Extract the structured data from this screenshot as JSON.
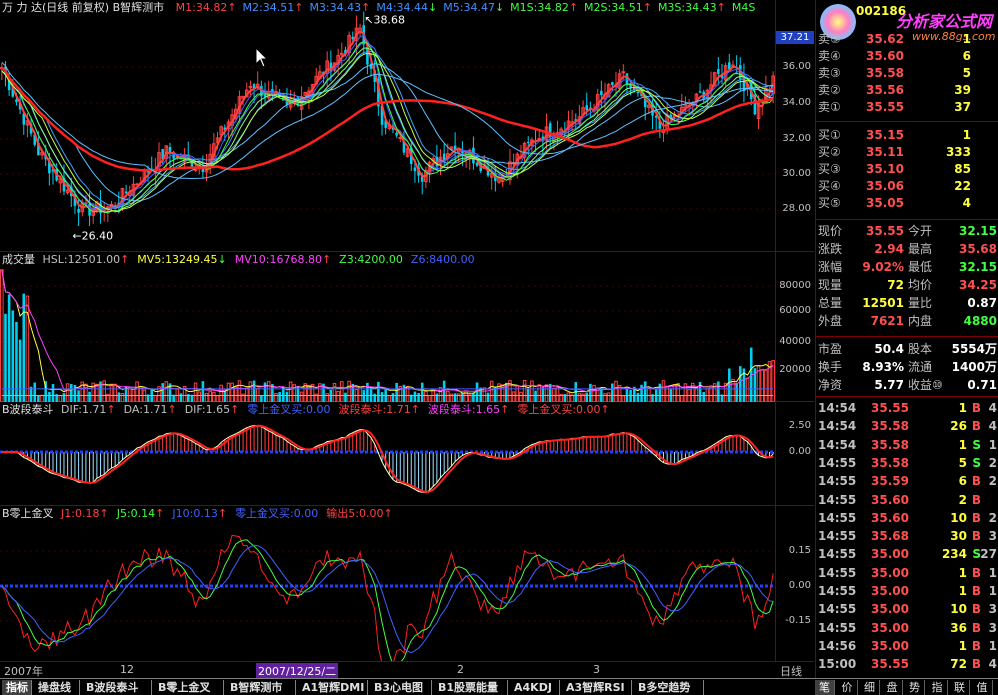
{
  "colors": {
    "up": "#ff4040",
    "down": "#00c0e0",
    "yellow": "#ffff40",
    "green": "#40ff40",
    "magenta": "#ff40ff",
    "white": "#ffffff",
    "blue": "#4060ff",
    "grid": "#800000"
  },
  "main": {
    "title": "万 力 达(日线 前复权) B智辉测市",
    "ma": [
      {
        "label": "M1:34.82",
        "color": "#ff4040",
        "arrow": "↑"
      },
      {
        "label": "M2:34.51",
        "color": "#4090ff",
        "arrow": "↑"
      },
      {
        "label": "M3:34.43",
        "color": "#4090ff",
        "arrow": "↑"
      },
      {
        "label": "M4:34.44",
        "color": "#4090ff",
        "arrow": "↓"
      },
      {
        "label": "M5:34.47",
        "color": "#4090ff",
        "arrow": "↓"
      },
      {
        "label": "M1S:34.82",
        "color": "#40ff40",
        "arrow": "↑"
      },
      {
        "label": "M2S:34.51",
        "color": "#40ff40",
        "arrow": "↑"
      },
      {
        "label": "M3S:34.43",
        "color": "#40ff40",
        "arrow": "↑"
      },
      {
        "label": "M4S",
        "color": "#40ff40",
        "arrow": ""
      }
    ],
    "high_label": "38.68",
    "low_label": "←26.40",
    "current_price_tag": "37.21",
    "axis": [
      "36.00",
      "34.00",
      "32.00",
      "30.00",
      "28.00"
    ]
  },
  "volume": {
    "title": "成交量",
    "items": [
      {
        "label": "HSL:12501.00",
        "color": "#c0c0c0",
        "arrow": "↑"
      },
      {
        "label": "MV5:13249.45",
        "color": "#ffff40",
        "arrow": "↓"
      },
      {
        "label": "MV10:16768.80",
        "color": "#ff40ff",
        "arrow": "↑"
      },
      {
        "label": "Z3:4200.00",
        "color": "#40ff40",
        "arrow": ""
      },
      {
        "label": "Z6:8400.00",
        "color": "#4060ff",
        "arrow": ""
      }
    ],
    "axis": [
      "80000",
      "60000",
      "40000",
      "20000"
    ]
  },
  "wave": {
    "title": "B波段泰斗",
    "items": [
      {
        "label": "DIF:1.71",
        "color": "#c0c0c0",
        "arrow": "↑"
      },
      {
        "label": "DA:1.71",
        "color": "#c0c0c0",
        "arrow": "↑"
      },
      {
        "label": "DIF:1.65",
        "color": "#c0c0c0",
        "arrow": "↑"
      },
      {
        "label": "零上金叉买:0.00",
        "color": "#4060ff",
        "arrow": ""
      },
      {
        "label": "波段泰斗:1.71",
        "color": "#ff4040",
        "arrow": "↑"
      },
      {
        "label": "波段泰斗:1.65",
        "color": "#ff40ff",
        "arrow": "↑"
      },
      {
        "label": "零上金叉买:0.00",
        "color": "#ff4040",
        "arrow": "↑"
      }
    ],
    "axis": [
      "2.50",
      "0.00"
    ]
  },
  "zero": {
    "title": "B零上金叉",
    "items": [
      {
        "label": "J1:0.18",
        "color": "#ff4040",
        "arrow": "↑"
      },
      {
        "label": "J5:0.14",
        "color": "#40ff40",
        "arrow": "↑"
      },
      {
        "label": "J10:0.13",
        "color": "#4060ff",
        "arrow": "↑"
      },
      {
        "label": "零上金叉买:0.00",
        "color": "#4060ff",
        "arrow": ""
      },
      {
        "label": "输出5:0.00",
        "color": "#ff4040",
        "arrow": "↑"
      }
    ],
    "axis": [
      "0.15",
      "0.00",
      "-0.15"
    ]
  },
  "date_axis": {
    "labels": [
      {
        "text": "2007年",
        "pos": 0.005
      },
      {
        "text": "12",
        "pos": 0.155
      },
      {
        "text": "2007/12/25/二",
        "pos": 0.33
      },
      {
        "text": "2",
        "pos": 0.59
      },
      {
        "text": "3",
        "pos": 0.765
      }
    ],
    "period": "日线"
  },
  "quote": {
    "code": "002186",
    "sell": [
      {
        "label": "卖⑤",
        "price": "35.62",
        "vol": "1"
      },
      {
        "label": "卖④",
        "price": "35.60",
        "vol": "6"
      },
      {
        "label": "卖③",
        "price": "35.58",
        "vol": "5"
      },
      {
        "label": "卖②",
        "price": "35.56",
        "vol": "39"
      },
      {
        "label": "卖①",
        "price": "35.55",
        "vol": "37"
      }
    ],
    "buy": [
      {
        "label": "买①",
        "price": "35.15",
        "vol": "1"
      },
      {
        "label": "买②",
        "price": "35.11",
        "vol": "333"
      },
      {
        "label": "买③",
        "price": "35.10",
        "vol": "85"
      },
      {
        "label": "买④",
        "price": "35.06",
        "vol": "22"
      },
      {
        "label": "买⑤",
        "price": "35.05",
        "vol": "4"
      }
    ],
    "stats": [
      {
        "l1": "现价",
        "v1": "35.55",
        "c1": "#ff5050",
        "l2": "今开",
        "v2": "32.15",
        "c2": "#40ff40"
      },
      {
        "l1": "涨跌",
        "v1": "2.94",
        "c1": "#ff5050",
        "l2": "最高",
        "v2": "35.68",
        "c2": "#ff5050"
      },
      {
        "l1": "涨幅",
        "v1": "9.02%",
        "c1": "#ff5050",
        "l2": "最低",
        "v2": "32.15",
        "c2": "#40ff40"
      },
      {
        "l1": "现量",
        "v1": "72",
        "c1": "#ffff40",
        "l2": "均价",
        "v2": "34.25",
        "c2": "#ff5050"
      },
      {
        "l1": "总量",
        "v1": "12501",
        "c1": "#ffff40",
        "l2": "量比",
        "v2": "0.87",
        "c2": "#ffffff"
      },
      {
        "l1": "外盘",
        "v1": "7621",
        "c1": "#ff5050",
        "l2": "内盘",
        "v2": "4880",
        "c2": "#40ff40"
      }
    ],
    "fund": [
      {
        "l1": "市盈",
        "v1": "50.4",
        "c1": "#ffffff",
        "l2": "股本",
        "v2": "5554万",
        "c2": "#ffffff"
      },
      {
        "l1": "换手",
        "v1": "8.93%",
        "c1": "#ffffff",
        "l2": "流通",
        "v2": "1400万",
        "c2": "#ffffff"
      },
      {
        "l1": "净资",
        "v1": "5.77",
        "c1": "#ffffff",
        "l2": "收益⑩",
        "v2": "0.71",
        "c2": "#ffffff"
      }
    ],
    "ticks": [
      {
        "t": "14:54",
        "p": "35.55",
        "v": "1",
        "bs": "B",
        "c": "#ff5050",
        "e": "4"
      },
      {
        "t": "14:54",
        "p": "35.58",
        "v": "26",
        "bs": "B",
        "c": "#ff5050",
        "e": "4"
      },
      {
        "t": "14:54",
        "p": "35.58",
        "v": "1",
        "bs": "S",
        "c": "#40ff40",
        "e": "1"
      },
      {
        "t": "14:55",
        "p": "35.58",
        "v": "5",
        "bs": "S",
        "c": "#40ff40",
        "e": "2"
      },
      {
        "t": "14:55",
        "p": "35.59",
        "v": "6",
        "bs": "B",
        "c": "#ff5050",
        "e": "2"
      },
      {
        "t": "14:55",
        "p": "35.60",
        "v": "2",
        "bs": "B",
        "c": "#ff5050",
        "e": ""
      },
      {
        "t": "14:55",
        "p": "35.60",
        "v": "10",
        "bs": "B",
        "c": "#ff5050",
        "e": "2"
      },
      {
        "t": "14:55",
        "p": "35.68",
        "v": "30",
        "bs": "B",
        "c": "#ff5050",
        "e": "3"
      },
      {
        "t": "14:55",
        "p": "35.00",
        "v": "234",
        "bs": "S",
        "c": "#40ff40",
        "e": "27"
      },
      {
        "t": "14:55",
        "p": "35.00",
        "v": "1",
        "bs": "B",
        "c": "#ff5050",
        "e": "1"
      },
      {
        "t": "14:55",
        "p": "35.00",
        "v": "1",
        "bs": "B",
        "c": "#ff5050",
        "e": "1"
      },
      {
        "t": "14:55",
        "p": "35.00",
        "v": "10",
        "bs": "B",
        "c": "#ff5050",
        "e": "3"
      },
      {
        "t": "14:55",
        "p": "35.00",
        "v": "36",
        "bs": "B",
        "c": "#ff5050",
        "e": "3"
      },
      {
        "t": "14:56",
        "p": "35.00",
        "v": "1",
        "bs": "B",
        "c": "#ff5050",
        "e": "1"
      },
      {
        "t": "15:00",
        "p": "35.55",
        "v": "72",
        "bs": "B",
        "c": "#ff5050",
        "e": "4"
      }
    ]
  },
  "watermark": {
    "title": "分析家公式网",
    "url": "www.88gs.com"
  },
  "tabs": [
    "指标",
    "操盘线",
    "B波段泰斗",
    "B零上金叉",
    "B智辉测市",
    "A1智辉DMI",
    "B3心电图",
    "B1股票能量",
    "A4KDJ",
    "A3智辉RSI",
    "B多空趋势"
  ],
  "right_tabs": [
    "笔",
    "价",
    "细",
    "盘",
    "势",
    "指",
    "联",
    "值"
  ]
}
